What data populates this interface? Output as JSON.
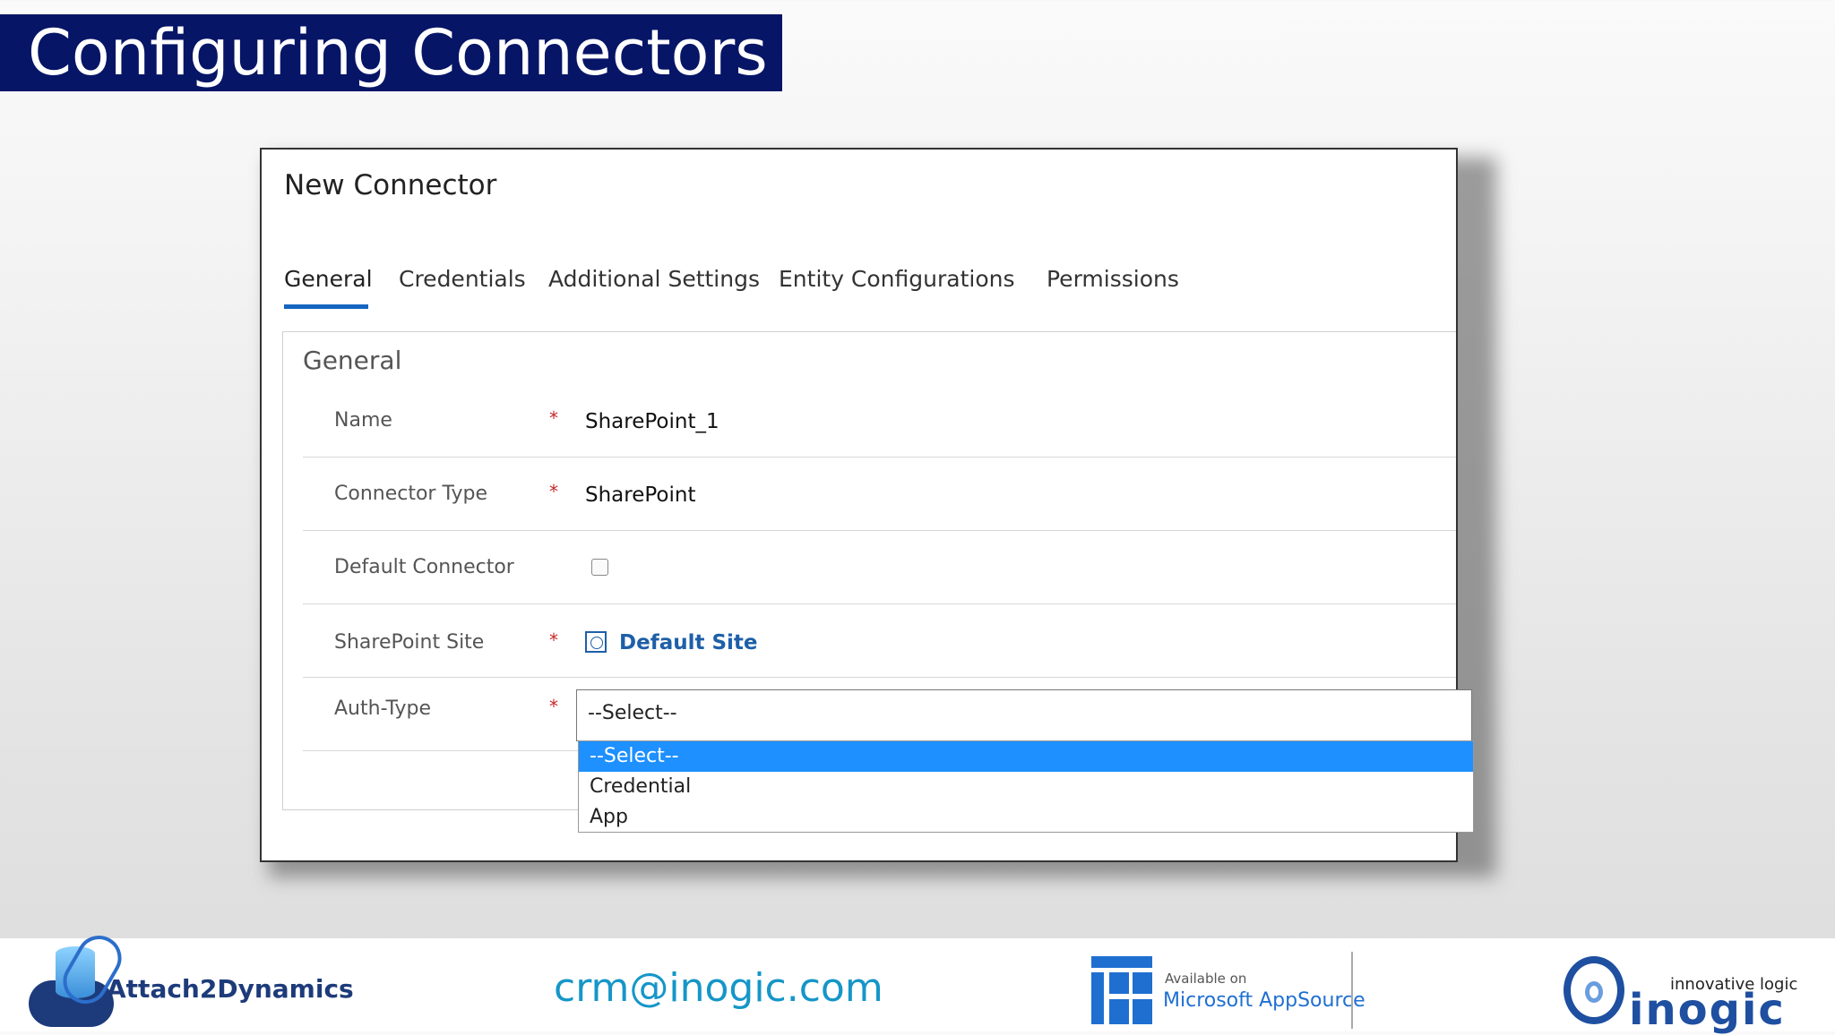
{
  "slide": {
    "title": "Configuring Connectors"
  },
  "dialog": {
    "title": "New Connector",
    "tabs": [
      {
        "label": "General",
        "active": true
      },
      {
        "label": "Credentials",
        "active": false
      },
      {
        "label": "Additional Settings",
        "active": false
      },
      {
        "label": "Entity Configurations",
        "active": false
      },
      {
        "label": "Permissions",
        "active": false
      }
    ],
    "section": {
      "title": "General",
      "fields": {
        "name": {
          "label": "Name",
          "required": "*",
          "value": "SharePoint_1"
        },
        "connector_type": {
          "label": "Connector Type",
          "required": "*",
          "value": "SharePoint"
        },
        "default_connector": {
          "label": "Default Connector",
          "checked": false
        },
        "sharepoint_site": {
          "label": "SharePoint Site",
          "required": "*",
          "value": "Default Site"
        },
        "auth_type": {
          "label": "Auth-Type",
          "required": "*",
          "selected": "--Select--",
          "options": [
            "--Select--",
            "Credential",
            "App"
          ],
          "highlighted_option": "--Select--"
        }
      }
    }
  },
  "footer": {
    "product_name": "Attach2Dynamics",
    "email": "crm@inogic.com",
    "appsource_small": "Available on",
    "appsource_big": "Microsoft AppSource",
    "company_tagline": "innovative logic",
    "company_name": "inogic"
  },
  "colors": {
    "title_banner": "#061566",
    "tab_underline": "#1565c0",
    "required": "#c62828",
    "link": "#1e5fa8",
    "dropdown_highlight": "#1e90ff",
    "email": "#1596c8"
  }
}
